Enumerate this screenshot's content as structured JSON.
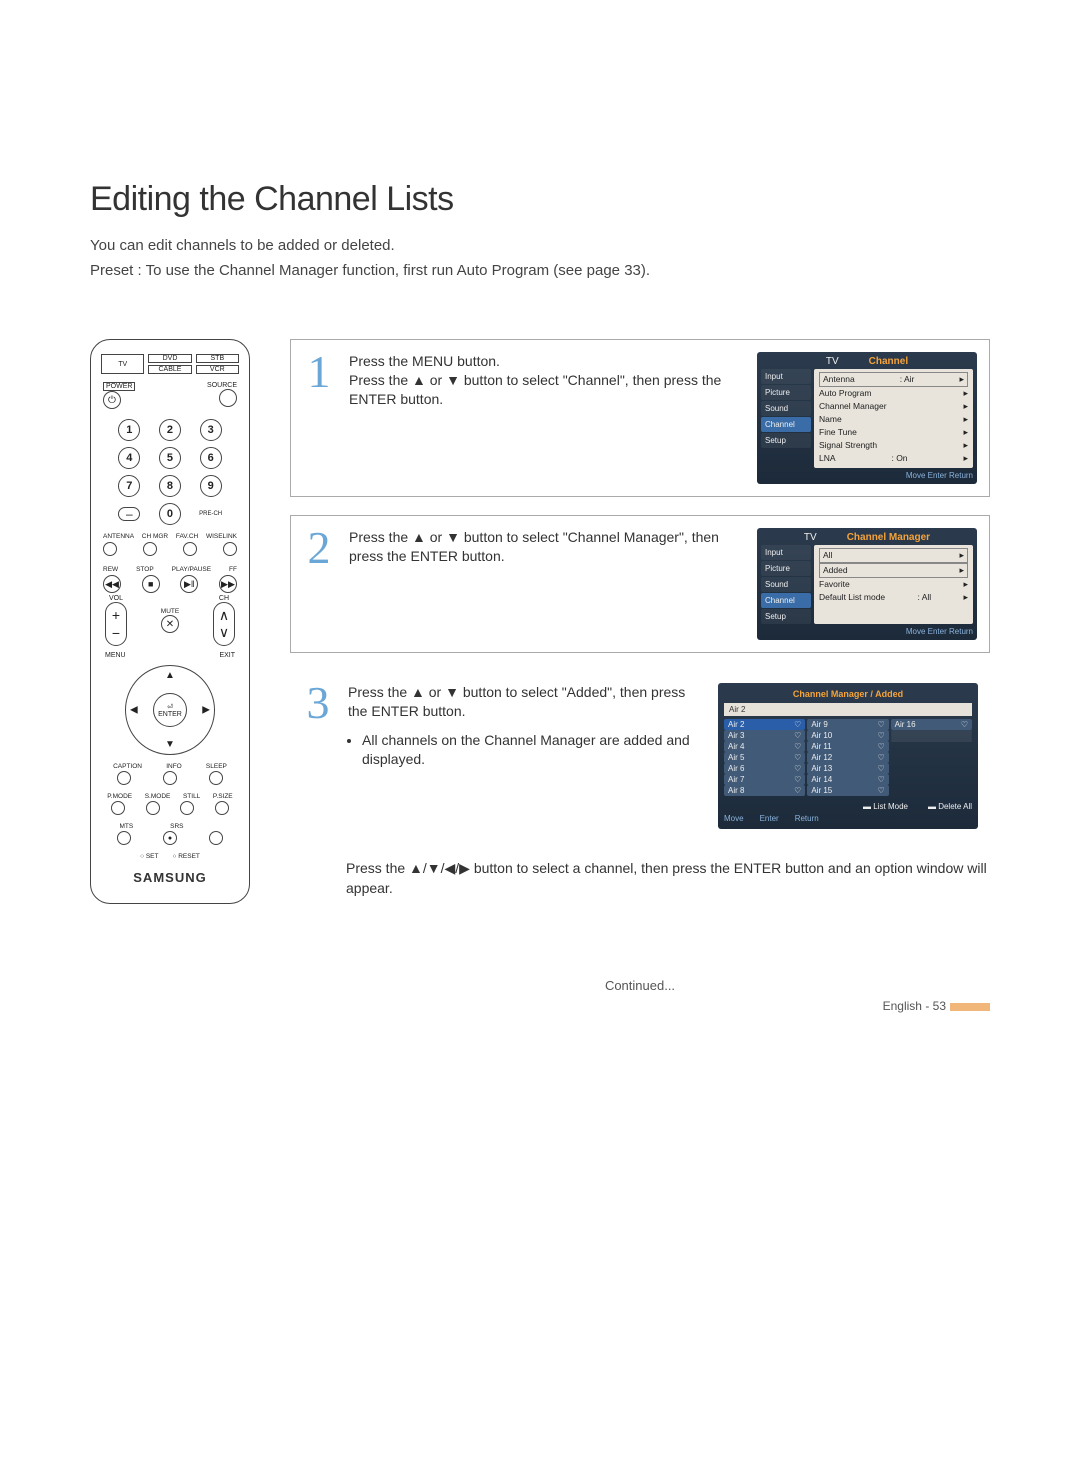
{
  "page": {
    "title": "Editing the Channel Lists",
    "intro1": "You can edit channels to be added or deleted.",
    "intro2": "Preset : To use the Channel Manager function, first run Auto Program (see page 33).",
    "continued": "Continued...",
    "footer": "English - 53"
  },
  "remote": {
    "devices": {
      "tv": "TV",
      "dvd": "DVD",
      "stb": "STB",
      "cable": "CABLE",
      "vcr": "VCR"
    },
    "power": "POWER",
    "source": "SOURCE",
    "num1": "1",
    "num2": "2",
    "num3": "3",
    "num4": "4",
    "num5": "5",
    "num6": "6",
    "num7": "7",
    "num8": "8",
    "num9": "9",
    "num0": "0",
    "dash": "–",
    "prech": "PRE-CH",
    "func": {
      "antenna": "ANTENNA",
      "chmgr": "CH MGR",
      "favch": "FAV.CH",
      "wiselink": "WISELINK"
    },
    "trans": {
      "rew": "REW",
      "stop": "STOP",
      "play": "PLAY/PAUSE",
      "ff": "FF"
    },
    "vol": "VOL",
    "ch": "CH",
    "mute": "MUTE",
    "menu": "MENU",
    "exit": "EXIT",
    "enter": "ENTER",
    "caption": "CAPTION",
    "info": "INFO",
    "sleep": "SLEEP",
    "pmode": "P.MODE",
    "smode": "S.MODE",
    "still": "STILL",
    "psize": "P.SIZE",
    "mts": "MTS",
    "srs": "SRS",
    "set": "SET",
    "reset": "RESET",
    "brand": "SAMSUNG"
  },
  "steps": {
    "s1": {
      "num": "1",
      "text": "Press the MENU button.\nPress the ▲ or ▼ button to select \"Channel\", then press the ENTER button."
    },
    "s2": {
      "num": "2",
      "text": "Press the ▲ or ▼ button to select \"Channel Manager\", then press the ENTER button."
    },
    "s3": {
      "num": "3",
      "text": "Press the ▲ or ▼ button to select \"Added\", then press the ENTER button.",
      "bullet": "All channels on the Channel Manager are added and displayed."
    },
    "after": "Press the ▲/▼/◀/▶ button to select a channel, then press the ENTER button and an option window will appear."
  },
  "osd1": {
    "tv": "TV",
    "title": "Channel",
    "tabs": [
      "Input",
      "Picture",
      "Sound",
      "Channel",
      "Setup"
    ],
    "rows": [
      {
        "l": "Antenna",
        "r": ": Air"
      },
      {
        "l": "Auto Program",
        "r": ""
      },
      {
        "l": "Channel Manager",
        "r": ""
      },
      {
        "l": "Name",
        "r": ""
      },
      {
        "l": "Fine Tune",
        "r": ""
      },
      {
        "l": "Signal Strength",
        "r": ""
      },
      {
        "l": "LNA",
        "r": ": On"
      }
    ],
    "footer": "Move    Enter    Return"
  },
  "osd2": {
    "tv": "TV",
    "title": "Channel Manager",
    "tabs": [
      "Input",
      "Picture",
      "Sound",
      "Channel",
      "Setup"
    ],
    "rows": [
      {
        "l": "All",
        "r": ""
      },
      {
        "l": "Added",
        "r": ""
      },
      {
        "l": "Favorite",
        "r": ""
      },
      {
        "l": "Default List mode",
        "r": ": All"
      }
    ],
    "footer": "Move    Enter    Return"
  },
  "osd3": {
    "title": "Channel Manager / Added",
    "air2": "Air 2",
    "col1": [
      "Air 2",
      "Air 3",
      "Air 4",
      "Air 5",
      "Air 6",
      "Air 7",
      "Air 8"
    ],
    "col2": [
      "Air 9",
      "Air 10",
      "Air 11",
      "Air 12",
      "Air 13",
      "Air 14",
      "Air 15"
    ],
    "col3": [
      "Air 16"
    ],
    "listmode": "List Mode",
    "deleteall": "Delete All",
    "foot": [
      "Move",
      "Enter",
      "Return"
    ]
  }
}
